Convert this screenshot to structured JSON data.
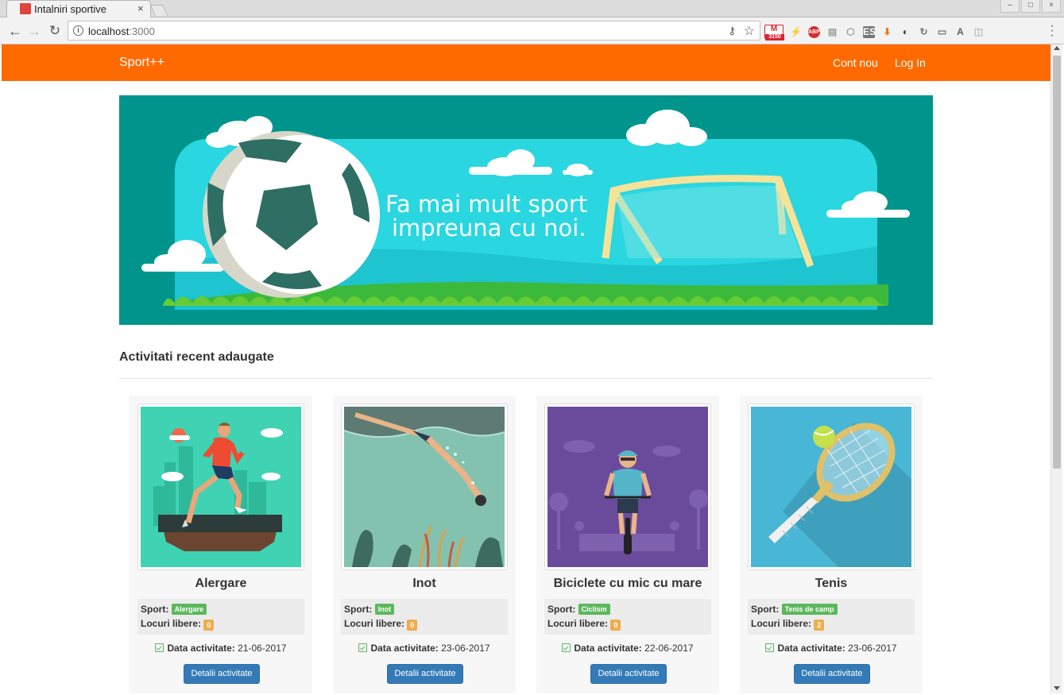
{
  "browser": {
    "tab_title": "Intalniri sportive",
    "tab_close": "×",
    "url_host": "localhost",
    "url_port": ":3000",
    "extensions": [
      {
        "name": "gmail-extension-icon",
        "label": "M",
        "badge": "3150",
        "color": "#d32f2f"
      },
      {
        "name": "bolt-extension-icon",
        "label": "⚡",
        "color": "#444444"
      },
      {
        "name": "adblock-extension-icon",
        "label": "ABP",
        "color": "#d32f2f"
      },
      {
        "name": "chat-extension-icon",
        "label": "▤",
        "color": "#9e9e9e"
      },
      {
        "name": "cube-extension-icon",
        "label": "⬡",
        "color": "#9e9e9e"
      },
      {
        "name": "es-extension-icon",
        "label": "ES",
        "color": "#757575"
      },
      {
        "name": "download-extension-icon",
        "label": "⬇",
        "color": "#e67e22"
      },
      {
        "name": "contrast-extension-icon",
        "label": "◐",
        "color": "#333333"
      },
      {
        "name": "refresh-extension-icon",
        "label": "↻",
        "color": "#757575"
      },
      {
        "name": "screen-extension-icon",
        "label": "▭",
        "color": "#757575"
      },
      {
        "name": "angular-extension-icon",
        "label": "A",
        "color": "#616161"
      },
      {
        "name": "toggle-extension-icon",
        "label": "◫",
        "color": "#bdbdbd"
      }
    ]
  },
  "navbar": {
    "brand": "Sport++",
    "signup": "Cont nou",
    "login": "Log In",
    "color": "#ff6a00"
  },
  "hero": {
    "line1": "Fa mai mult sport",
    "line2": "impreuna cu noi."
  },
  "section": {
    "title": "Activitati recent adaugate"
  },
  "labels": {
    "sport": "Sport:",
    "places": "Locuri libere:",
    "date": "Data activitate:",
    "details": "Detalii activitate"
  },
  "cards": [
    {
      "title": "Alergare",
      "sport": "Alergare",
      "places": "0",
      "date": "21-06-2017",
      "image": "runner"
    },
    {
      "title": "Inot",
      "sport": "Inot",
      "places": "0",
      "date": "23-06-2017",
      "image": "swimmer"
    },
    {
      "title": "Biciclete cu mic cu mare",
      "sport": "Ciclism",
      "places": "0",
      "date": "22-06-2017",
      "image": "cyclist"
    },
    {
      "title": "Tenis",
      "sport": "Tenis de camp",
      "places": "2",
      "date": "23-06-2017",
      "image": "tennis-racket"
    }
  ]
}
